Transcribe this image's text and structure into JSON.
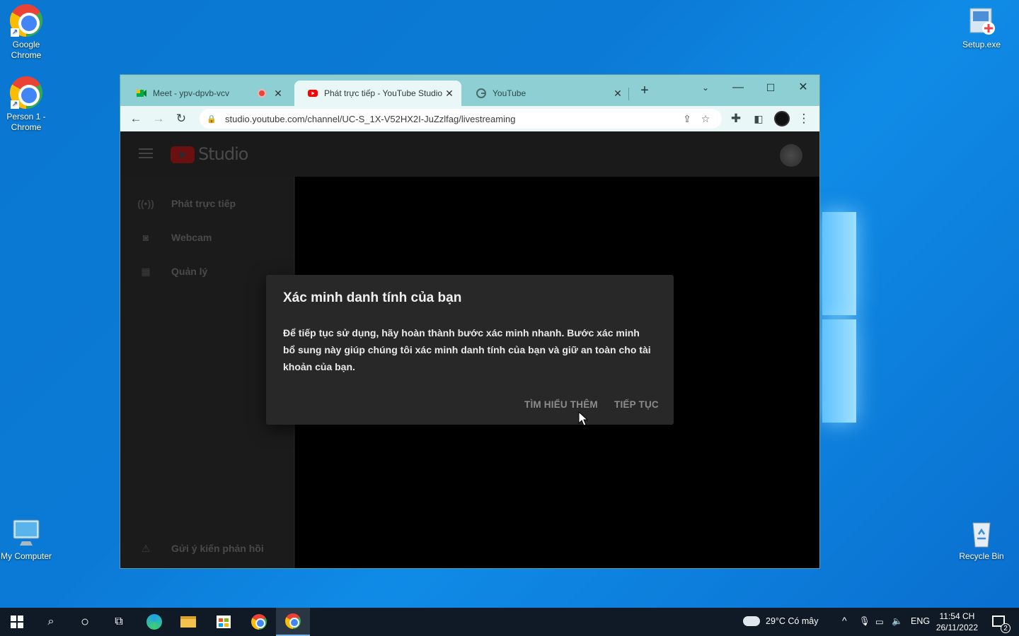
{
  "desktop": {
    "icons": [
      {
        "label": "Google Chrome",
        "icon": "chrome-icon"
      },
      {
        "label": "Person 1 - Chrome",
        "icon": "chrome-profile-icon"
      },
      {
        "label": "Setup.exe",
        "icon": "setup-icon"
      },
      {
        "label": "My Computer",
        "icon": "computer-icon"
      },
      {
        "label": "Recycle Bin",
        "icon": "recycle-bin-icon"
      }
    ]
  },
  "browser": {
    "tabs": [
      {
        "title": "Meet - ypv-dpvb-vcv",
        "icon": "google-meet-icon",
        "recording": true
      },
      {
        "title": "Phát trực tiếp - YouTube Studio",
        "icon": "youtube-icon",
        "active": true
      },
      {
        "title": "YouTube",
        "icon": "google-icon"
      }
    ],
    "url": "studio.youtube.com/channel/UC-S_1X-V52HX2I-JuZzlfag/livestreaming"
  },
  "studio": {
    "logo_text": "Studio",
    "sidebar": [
      {
        "label": "Phát trực tiếp",
        "icon": "live-icon"
      },
      {
        "label": "Webcam",
        "icon": "webcam-icon"
      },
      {
        "label": "Quản lý",
        "icon": "calendar-icon"
      }
    ],
    "feedback": "Gửi ý kiến phản hồi"
  },
  "dialog": {
    "title": "Xác minh danh tính của bạn",
    "body": "Để tiếp tục sử dụng, hãy hoàn thành bước xác minh nhanh. Bước xác minh bổ sung này giúp chúng tôi xác minh danh tính của bạn và giữ an toàn cho tài khoản của bạn.",
    "learn_more": "TÌM HIỂU THÊM",
    "continue": "TIẾP TỤC"
  },
  "taskbar": {
    "weather": "29°C  Có mây",
    "language": "ENG",
    "time": "11:54 CH",
    "date": "26/11/2022",
    "notifications": "2"
  }
}
